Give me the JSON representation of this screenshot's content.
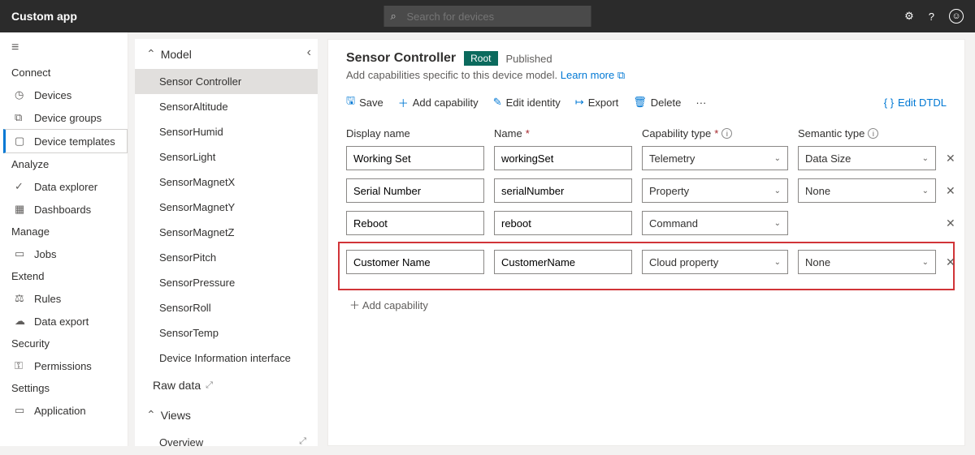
{
  "app": {
    "title": "Custom app"
  },
  "search": {
    "placeholder": "Search for devices"
  },
  "nav": {
    "sections": {
      "connect": "Connect",
      "analyze": "Analyze",
      "manage": "Manage",
      "extend": "Extend",
      "security": "Security",
      "settings": "Settings"
    },
    "items": {
      "devices": "Devices",
      "device_groups": "Device groups",
      "device_templates": "Device templates",
      "data_explorer": "Data explorer",
      "dashboards": "Dashboards",
      "jobs": "Jobs",
      "rules": "Rules",
      "data_export": "Data export",
      "permissions": "Permissions",
      "application": "Application"
    }
  },
  "tree": {
    "model": "Model",
    "items": [
      "Sensor Controller",
      "SensorAltitude",
      "SensorHumid",
      "SensorLight",
      "SensorMagnetX",
      "SensorMagnetY",
      "SensorMagnetZ",
      "SensorPitch",
      "SensorPressure",
      "SensorRoll",
      "SensorTemp",
      "Device Information interface"
    ],
    "raw_data": "Raw data",
    "views": "Views",
    "overview": "Overview"
  },
  "main": {
    "title": "Sensor Controller",
    "badge": "Root",
    "status": "Published",
    "subtitle": "Add capabilities specific to this device model.",
    "learn_more": "Learn more",
    "toolbar": {
      "save": "Save",
      "add": "Add capability",
      "edit_identity": "Edit identity",
      "export": "Export",
      "delete": "Delete",
      "edit_dtdl": "Edit DTDL"
    },
    "cols": {
      "display": "Display name",
      "name": "Name",
      "cap_type": "Capability type",
      "sem_type": "Semantic type"
    },
    "rows": [
      {
        "display": "Working Set",
        "name": "workingSet",
        "type": "Telemetry",
        "sem": "Data Size"
      },
      {
        "display": "Serial Number",
        "name": "serialNumber",
        "type": "Property",
        "sem": "None"
      },
      {
        "display": "Reboot",
        "name": "reboot",
        "type": "Command",
        "sem": ""
      },
      {
        "display": "Customer Name",
        "name": "CustomerName",
        "type": "Cloud property",
        "sem": "None"
      }
    ],
    "add_cap": "Add capability"
  }
}
